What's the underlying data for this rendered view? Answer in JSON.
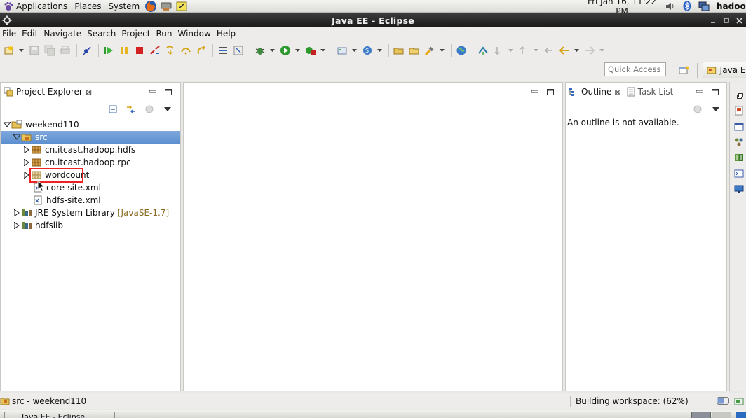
{
  "gnome_panel": {
    "menus": [
      {
        "label": "Applications",
        "icon": "gnome-foot-icon"
      },
      {
        "label": "Places",
        "icon": ""
      },
      {
        "label": "System",
        "icon": ""
      }
    ],
    "launchers": [
      "firefox-icon",
      "network-icon",
      "text-editor-icon"
    ],
    "clock": "Fri Jan 16, 11:22 PM",
    "tray": [
      "volume-icon",
      "bluetooth-icon",
      "network-monitor-icon"
    ],
    "username": "hadoop"
  },
  "window": {
    "title": "Java EE - Eclipse",
    "controls": [
      "minimize",
      "maximize",
      "close"
    ]
  },
  "menubar": {
    "items": [
      {
        "label": "File",
        "mnemonic": "F"
      },
      {
        "label": "Edit",
        "mnemonic": "E"
      },
      {
        "label": "Navigate",
        "mnemonic": "N"
      },
      {
        "label": "Search",
        "mnemonic": "a"
      },
      {
        "label": "Project",
        "mnemonic": "P"
      },
      {
        "label": "Run",
        "mnemonic": "R"
      },
      {
        "label": "Window",
        "mnemonic": "W"
      },
      {
        "label": "Help",
        "mnemonic": "H"
      }
    ]
  },
  "toolbar": {
    "quick_access_placeholder": "Quick Access",
    "perspective_label": "Java EE"
  },
  "project_explorer": {
    "tab_label": "Project Explorer",
    "tree": [
      {
        "label": "weekend110",
        "level": 0,
        "expanded": true,
        "icon": "project-icon",
        "selected": false
      },
      {
        "label": "src",
        "level": 1,
        "expanded": true,
        "icon": "source-folder-icon",
        "selected": true
      },
      {
        "label": "cn.itcast.hadoop.hdfs",
        "level": 2,
        "expanded": false,
        "icon": "package-icon",
        "selected": false
      },
      {
        "label": "cn.itcast.hadoop.rpc",
        "level": 2,
        "expanded": false,
        "icon": "package-icon",
        "selected": false
      },
      {
        "label": "wordcount",
        "level": 2,
        "expanded": false,
        "icon": "package-icon",
        "selected": false,
        "highlighted": true
      },
      {
        "label": "core-site.xml",
        "level": 2,
        "expanded": null,
        "icon": "xml-file-icon",
        "selected": false
      },
      {
        "label": "hdfs-site.xml",
        "level": 2,
        "expanded": null,
        "icon": "xml-file-icon",
        "selected": false
      },
      {
        "label": "JRE System Library",
        "decoration": "[JavaSE-1.7]",
        "level": 1,
        "expanded": false,
        "icon": "library-icon",
        "selected": false
      },
      {
        "label": "hdfslib",
        "level": 1,
        "expanded": false,
        "icon": "library-icon",
        "selected": false
      }
    ]
  },
  "outline": {
    "tabs": [
      "Outline",
      "Task List"
    ],
    "message": "An outline is not available."
  },
  "status": {
    "left": "src - weekend110",
    "right": "Building workspace: (62%)",
    "progress": 0.62
  },
  "bottom_panel": {
    "task_label": "Java EE - Eclipse"
  }
}
